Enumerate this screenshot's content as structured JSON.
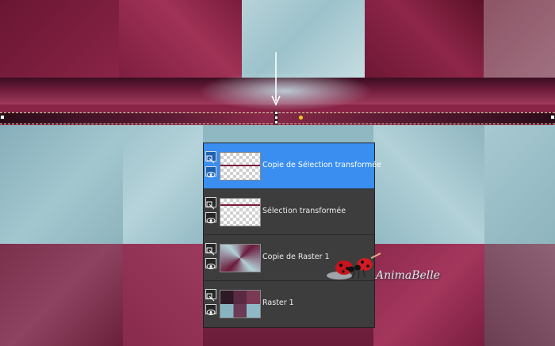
{
  "layers": [
    {
      "name": "Copie de Sélection transformée",
      "selected": true,
      "thumb": "transparent-line"
    },
    {
      "name": "Sélection transformée",
      "selected": false,
      "thumb": "transparent-line"
    },
    {
      "name": "Copie de Raster 1",
      "selected": false,
      "thumb": "abstract"
    },
    {
      "name": "Raster 1",
      "selected": false,
      "thumb": "abstract-tiles"
    }
  ],
  "watermark": {
    "text": "AnimaBelle"
  },
  "colors": {
    "accent_selected": "#3a8ef0",
    "panel_bg": "#3d3d3d",
    "wine": "#8a2447",
    "sky": "#98c0ca"
  },
  "icons": [
    "layer-type-icon",
    "eye-icon",
    "arrow-down-icon",
    "ladybug-icon"
  ]
}
